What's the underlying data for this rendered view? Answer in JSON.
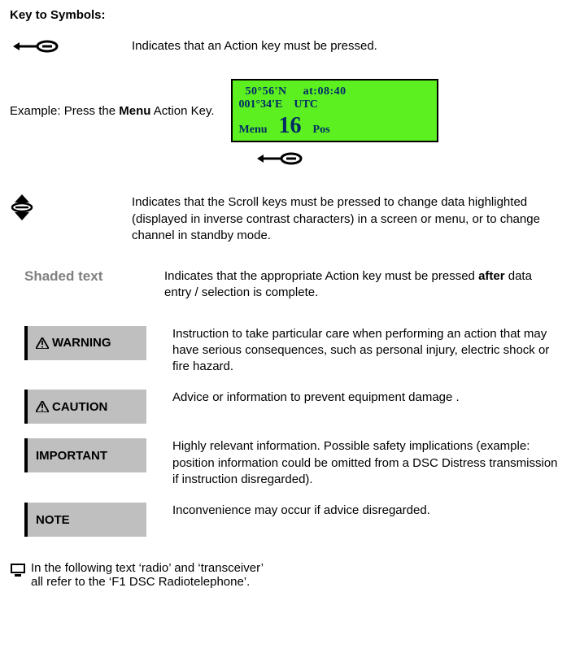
{
  "heading": "Key to Symbols:",
  "action_key": {
    "desc": "Indicates that an Action key must be pressed."
  },
  "example": {
    "prefix": "Example: Press the ",
    "bold": "Menu",
    "suffix": " Action Key."
  },
  "lcd": {
    "lat": "50°56'N",
    "at": "at:08:40",
    "lon": "001°34'E",
    "tz": "UTC",
    "left": "Menu",
    "center": "16",
    "right": "Pos"
  },
  "scroll": {
    "desc": "Indicates that the Scroll keys must be pressed to change data highlighted (displayed in inverse contrast characters) in a screen or menu, or to change channel in standby mode."
  },
  "shaded": {
    "label": "Shaded text",
    "desc_pre": "Indicates that the appropriate Action key must be pressed ",
    "desc_bold": "after",
    "desc_post": " data entry / selection is complete."
  },
  "warning": {
    "label": "WARNING",
    "desc": "Instruction to take particular care when performing an action that may have serious consequences, such as personal injury, electric shock or fire hazard."
  },
  "caution": {
    "label": "CAUTION",
    "desc": "Advice or information to prevent equipment damage ."
  },
  "important": {
    "label": "IMPORTANT",
    "desc": "Highly relevant information. Possible safety implications (example: position information could be omitted from a DSC Distress transmission if instruction disregarded)."
  },
  "note": {
    "label": "NOTE",
    "desc": "Inconvenience may occur if advice disregarded."
  },
  "footer": {
    "line1": "In the following text ‘radio’ and ‘transceiver’",
    "line2": "all refer to the ‘F1 DSC Radiotelephone’."
  }
}
